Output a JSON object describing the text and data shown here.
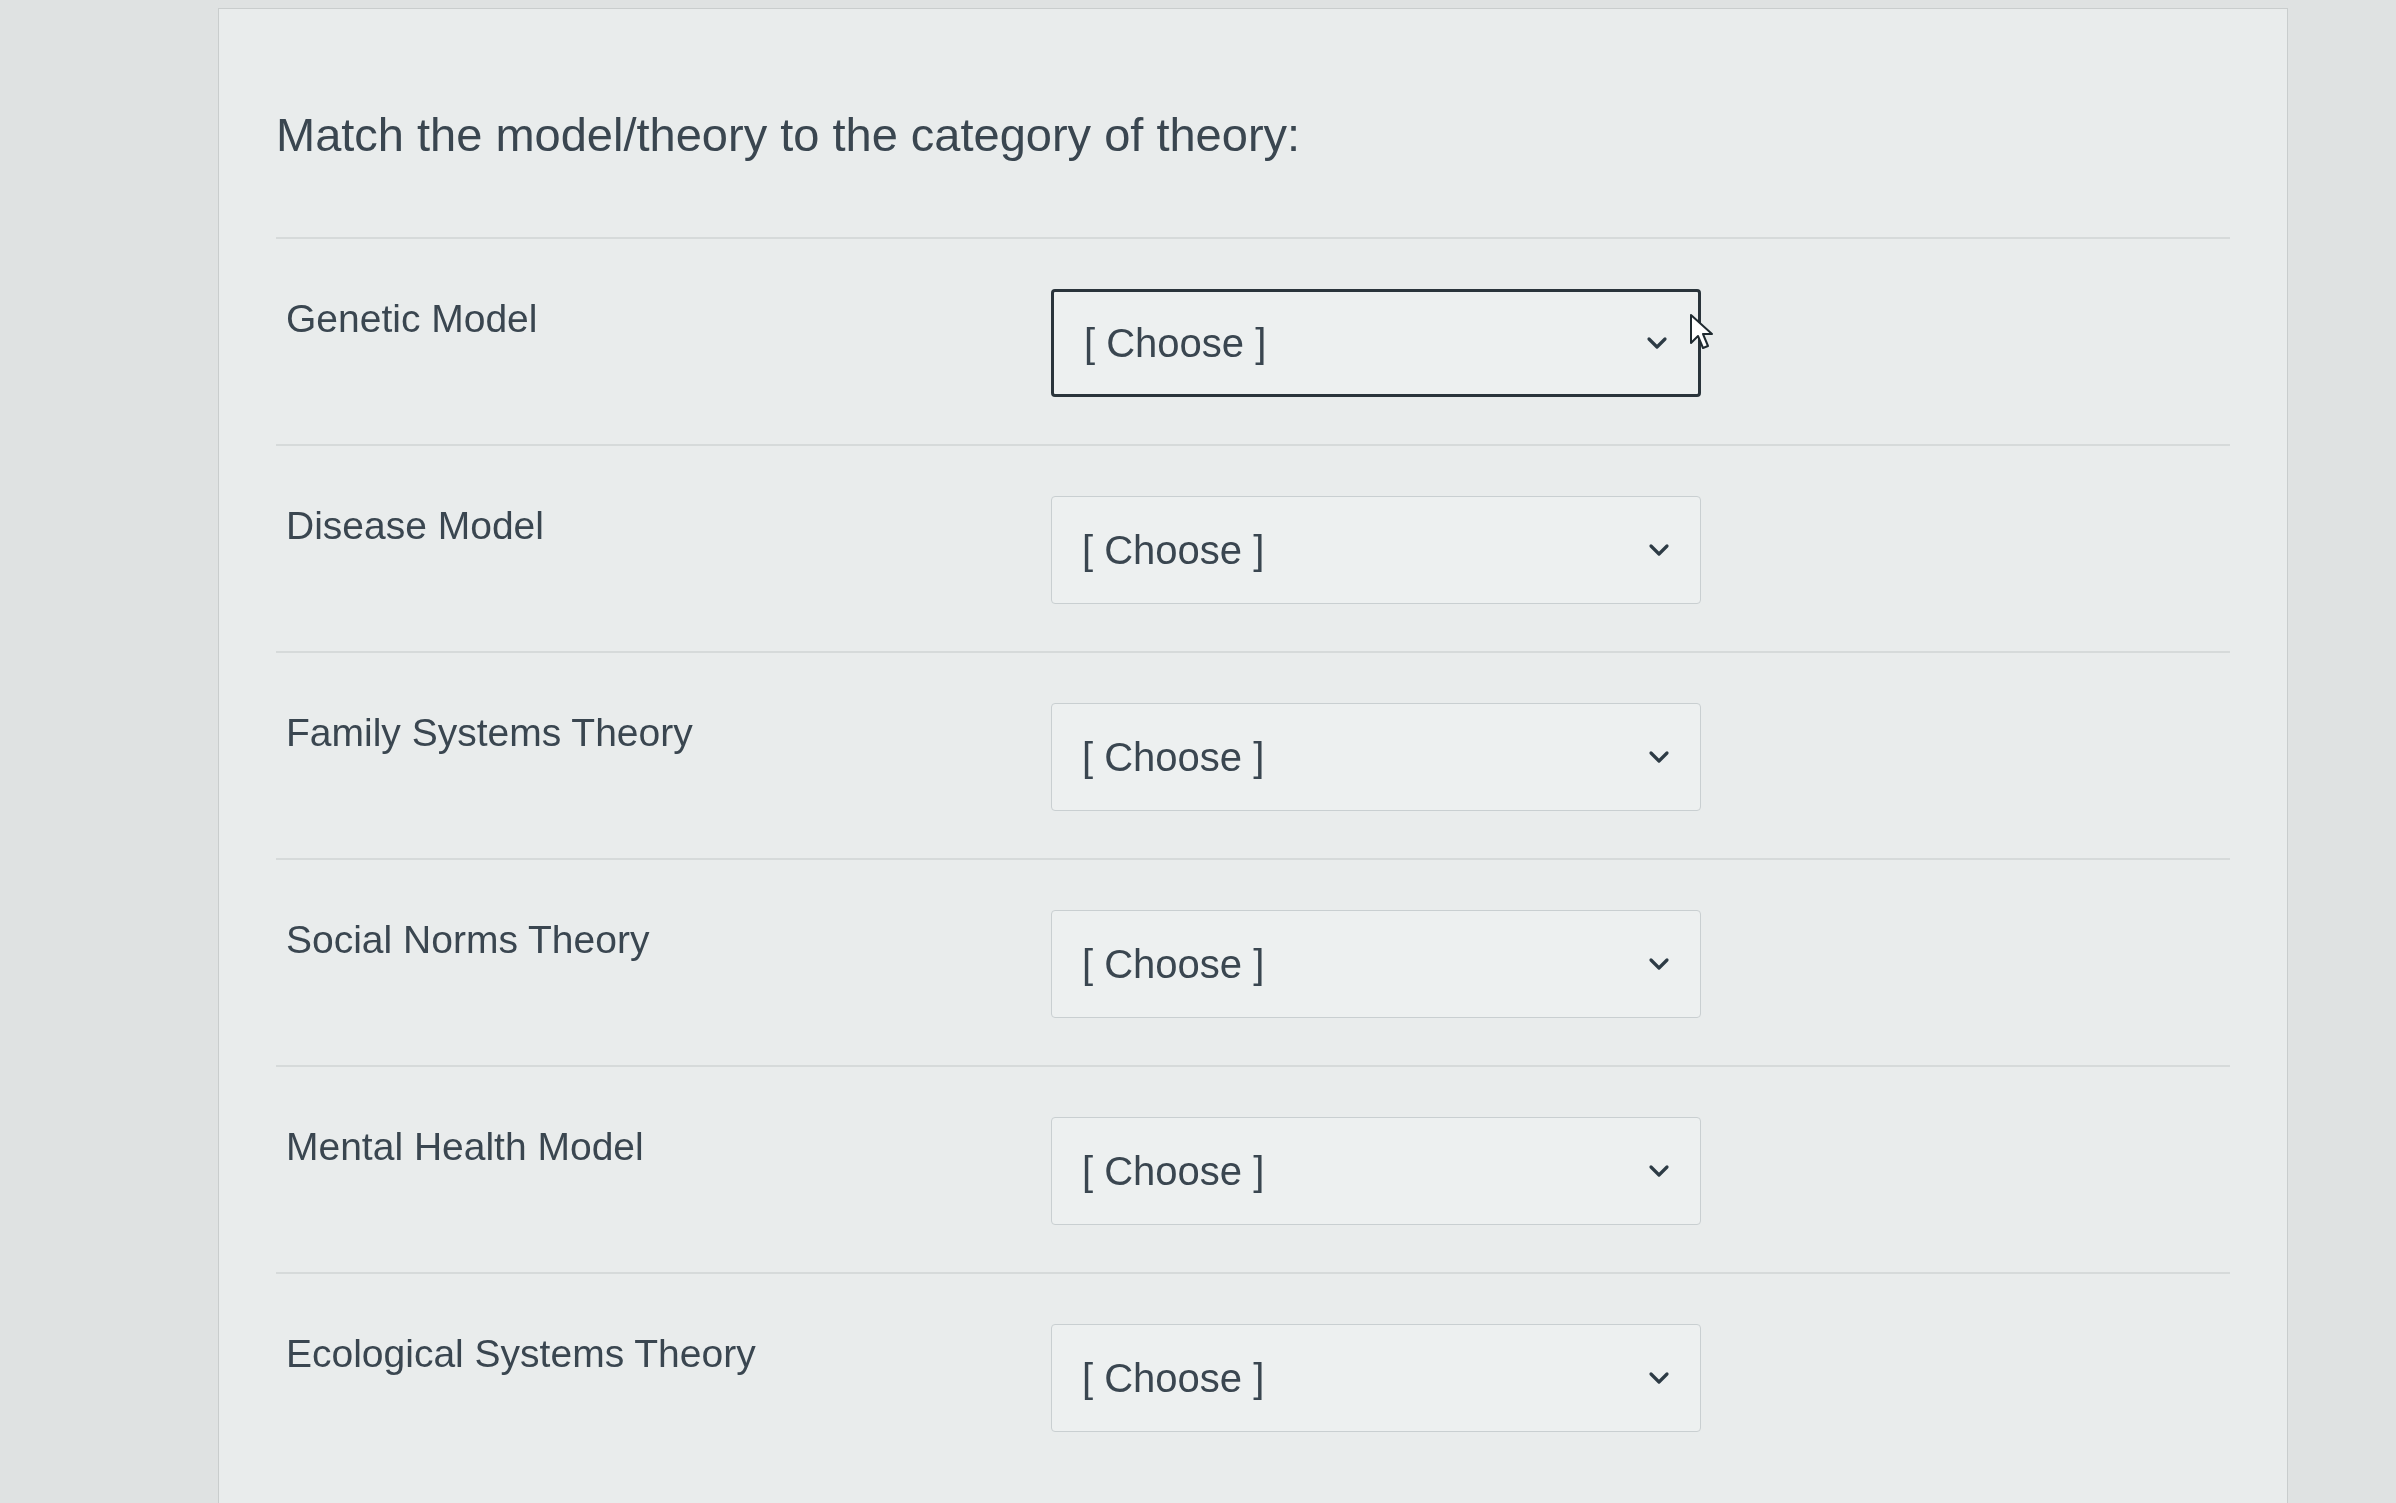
{
  "question": {
    "text": "Match the model/theory to the category of theory:"
  },
  "matches": [
    {
      "label": "Genetic Model",
      "select": {
        "value": "[ Choose ]",
        "focused": true
      }
    },
    {
      "label": "Disease Model",
      "select": {
        "value": "[ Choose ]",
        "focused": false
      }
    },
    {
      "label": "Family Systems Theory",
      "select": {
        "value": "[ Choose ]",
        "focused": false
      }
    },
    {
      "label": "Social Norms Theory",
      "select": {
        "value": "[ Choose ]",
        "focused": false
      }
    },
    {
      "label": "Mental Health Model",
      "select": {
        "value": "[ Choose ]",
        "focused": false
      }
    },
    {
      "label": "Ecological Systems Theory",
      "select": {
        "value": "[ Choose ]",
        "focused": false
      }
    }
  ]
}
